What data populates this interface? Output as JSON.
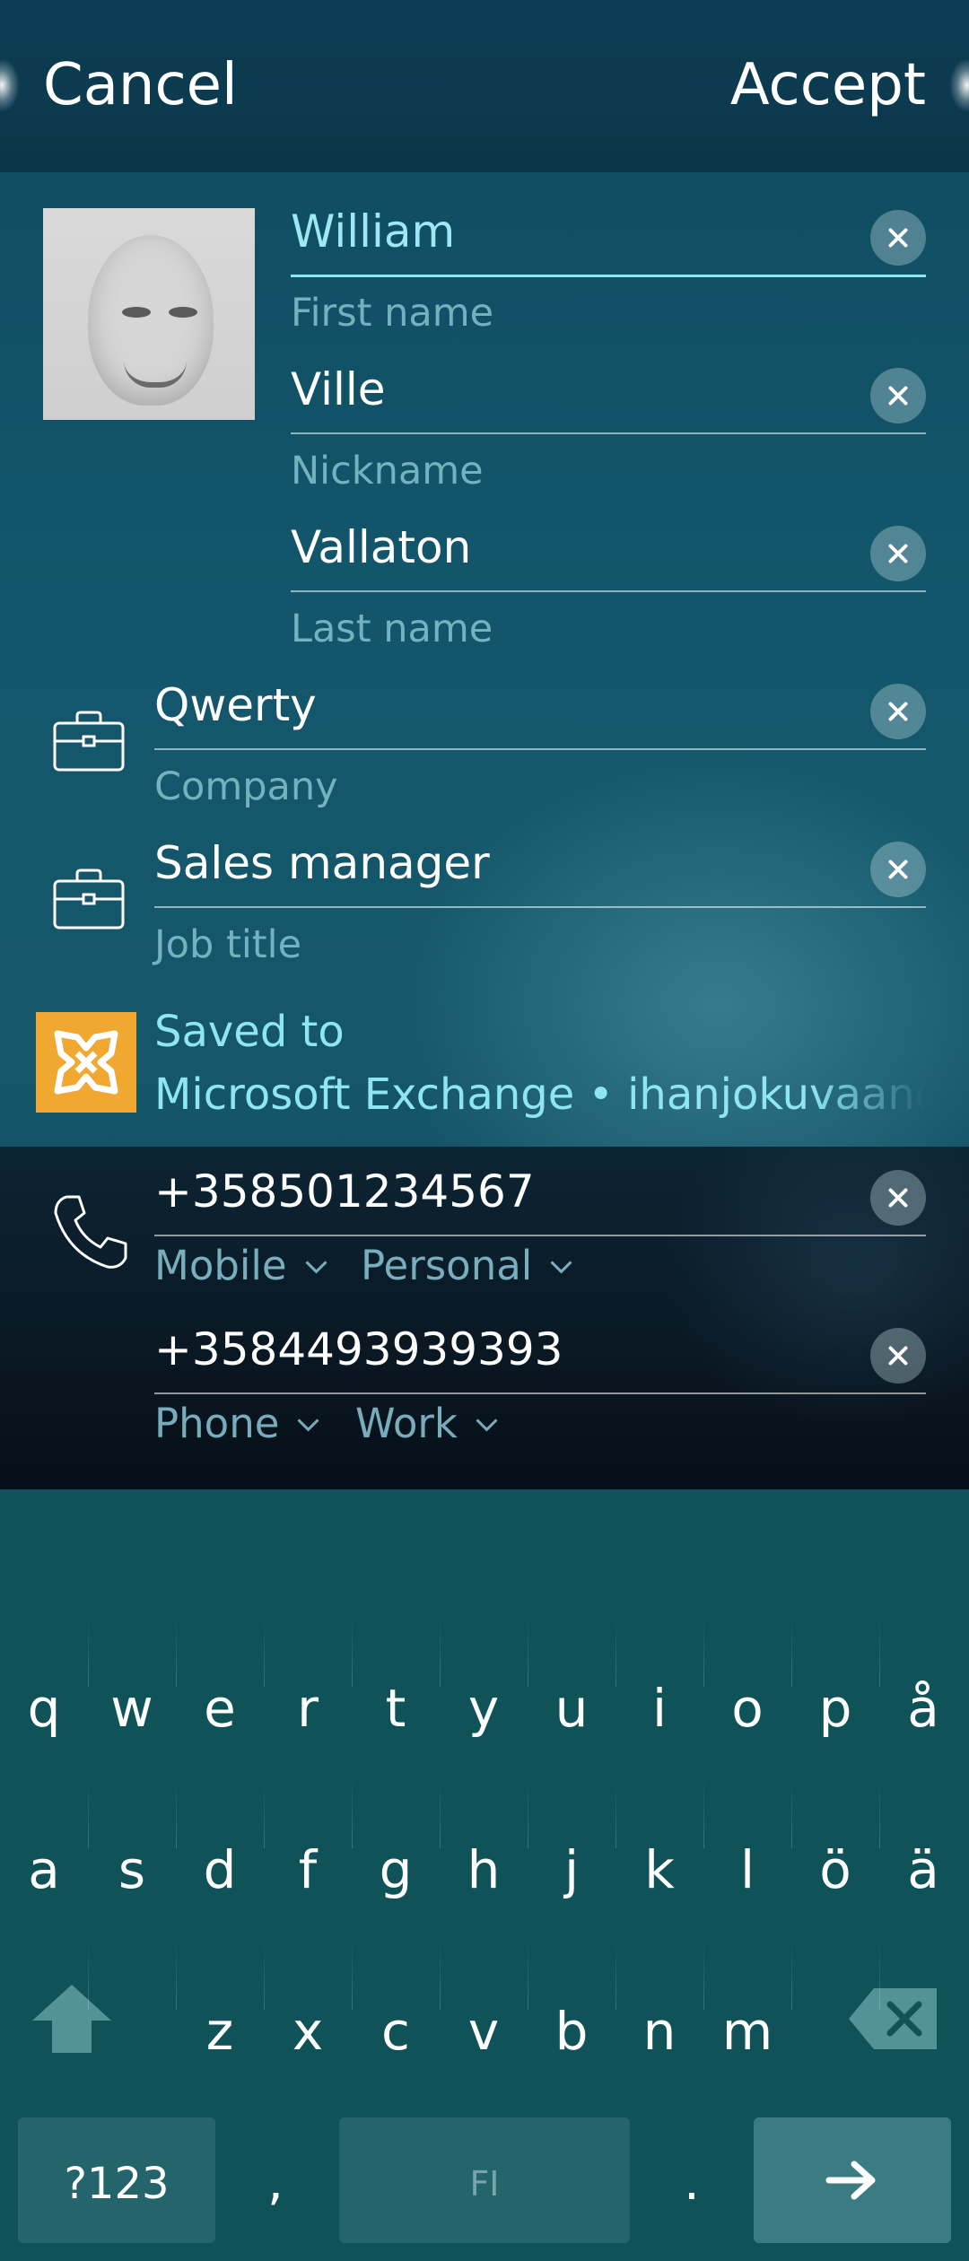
{
  "header": {
    "cancel_label": "Cancel",
    "accept_label": "Accept"
  },
  "name_fields": [
    {
      "value": "William",
      "label": "First name",
      "focused": true
    },
    {
      "value": "Ville",
      "label": "Nickname"
    },
    {
      "value": "Vallaton",
      "label": "Last name"
    }
  ],
  "work_fields": [
    {
      "value": "Qwerty",
      "label": "Company",
      "icon": "briefcase-icon"
    },
    {
      "value": "Sales manager",
      "label": "Job title",
      "icon": "briefcase-icon"
    }
  ],
  "saved_to": {
    "line1": "Saved to",
    "line2": "Microsoft Exchange • ihanjokuvaan@o",
    "icon": "exchange-logo-icon"
  },
  "phones": [
    {
      "value": "+358501234567",
      "type": "Mobile",
      "context": "Personal"
    },
    {
      "value": "+3584493939393",
      "type": "Phone",
      "context": "Work"
    }
  ],
  "keyboard": {
    "row1": [
      "q",
      "w",
      "e",
      "r",
      "t",
      "y",
      "u",
      "i",
      "o",
      "p",
      "å"
    ],
    "row2": [
      "a",
      "s",
      "d",
      "f",
      "g",
      "h",
      "j",
      "k",
      "l",
      "ö",
      "ä"
    ],
    "row3": [
      "z",
      "x",
      "c",
      "v",
      "b",
      "n",
      "m"
    ],
    "symbols_label": "?123",
    "comma": ",",
    "period": ".",
    "space_label": "FI",
    "enter_icon": "arrow-right-icon",
    "shift_icon": "shift-icon",
    "backspace_icon": "backspace-icon"
  },
  "colors": {
    "accent": "#8ee6f2",
    "exchange_orange": "#f0a830",
    "keyboard_bg": "#0f5258"
  }
}
